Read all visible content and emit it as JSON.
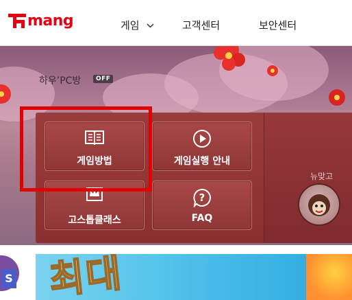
{
  "header": {
    "logo_text": "mang",
    "logo_prefix": "P",
    "nav": {
      "game": "게임",
      "support": "고객센터",
      "security": "보안센터"
    }
  },
  "banner": {
    "pc_label": "하우’PC방",
    "pc_status": "OFF",
    "buttons": {
      "how_to": "게임방법",
      "run_guide": "게임실행 안내",
      "go_stop": "고스톱클래스",
      "faq": "FAQ"
    },
    "side_label": "뉴맞고"
  },
  "lower_banner": {
    "text": "최대"
  },
  "left_badge": {
    "text": "S"
  },
  "colors": {
    "brand_red": "#e60012",
    "highlight": "#e00000",
    "panel": "#8f3636"
  }
}
